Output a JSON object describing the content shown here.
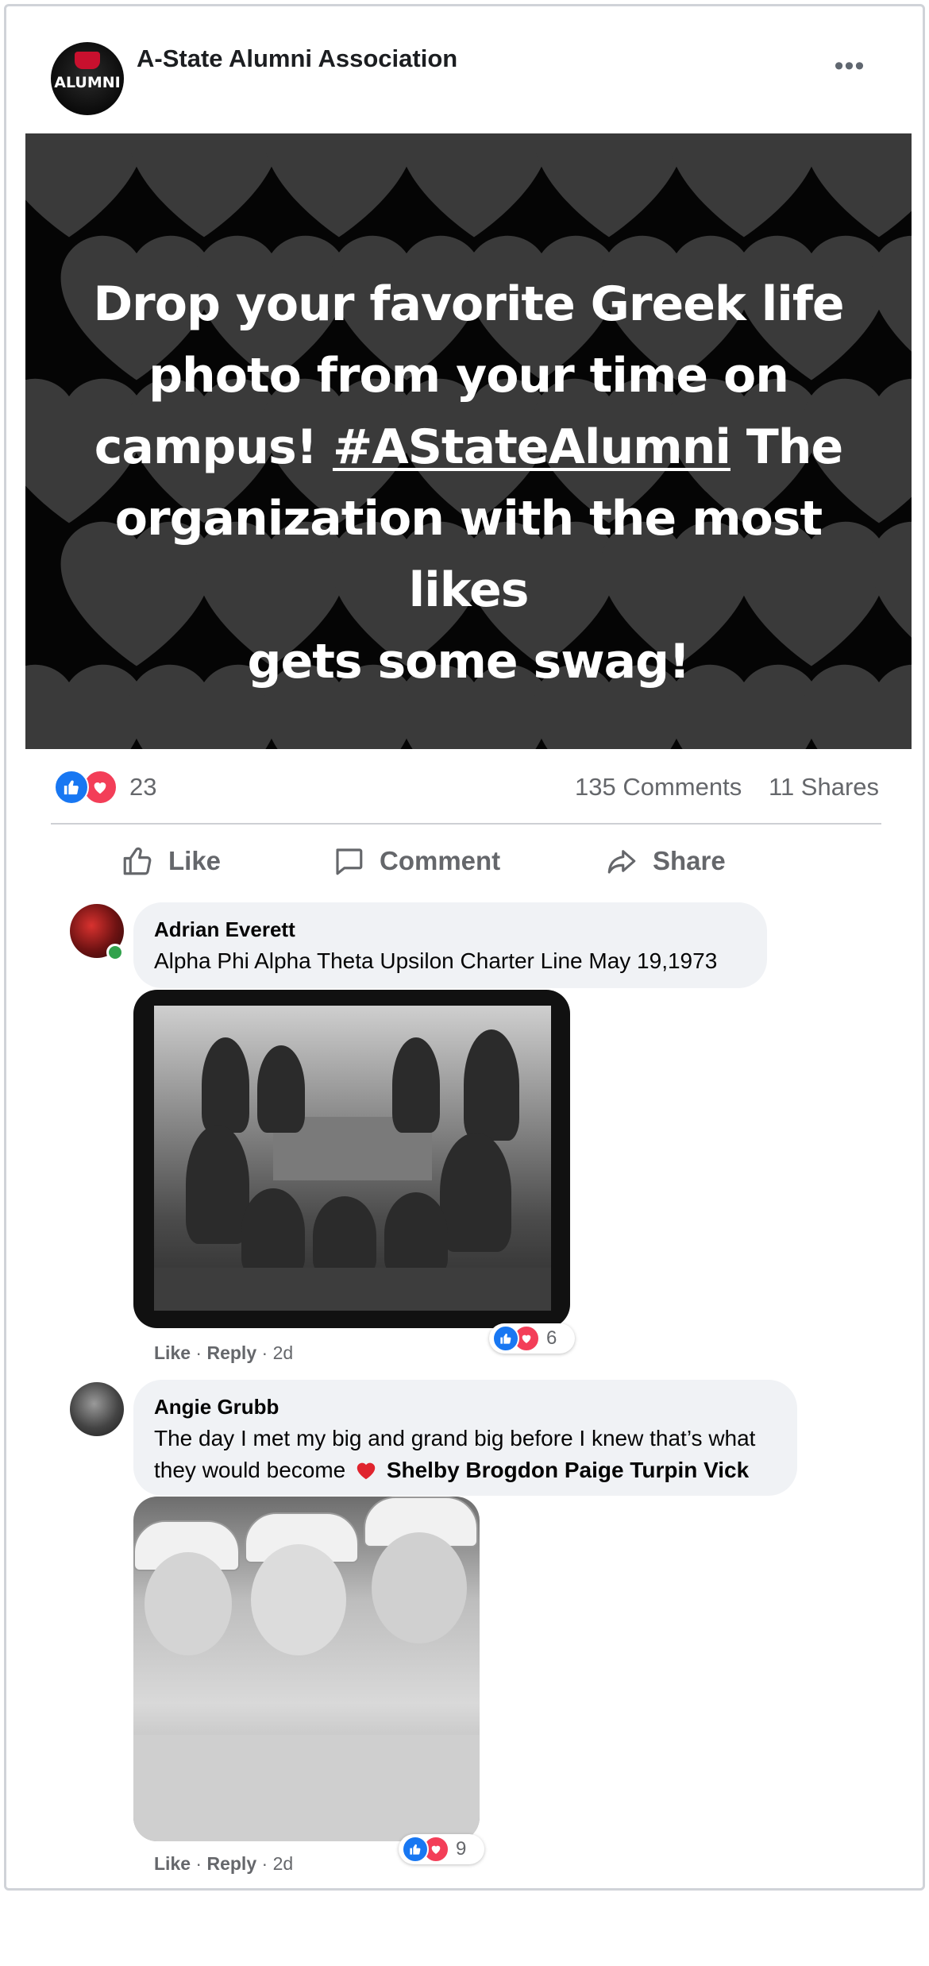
{
  "post": {
    "page_name": "A-State Alumni Association",
    "avatar_word": "ALUMNI",
    "more_label": "•••",
    "banner_text": {
      "line1": "Drop your favorite Greek life",
      "line2": "photo from your time on",
      "line3_pre": "campus! ",
      "hashtag": "#AStateAlumni",
      "line3_post": " The",
      "line4": "organization with the most likes",
      "line5": "gets some swag!"
    },
    "reactions_count": "23",
    "comments_count": "135 Comments",
    "shares_count": "11 Shares",
    "actions": {
      "like": "Like",
      "comment": "Comment",
      "share": "Share"
    }
  },
  "comments": [
    {
      "author": "Adrian Everett",
      "text": "Alpha Phi Alpha Theta Upsilon Charter Line May 19,1973",
      "reactions": "6",
      "like_label": "Like",
      "reply_label": "Reply",
      "time": "2d",
      "online": true
    },
    {
      "author": "Angie Grubb",
      "text_line1": "The day I met my big and grand big before I knew that’s what",
      "text_line2_pre": "they would become",
      "tagged": "Shelby Brogdon Paige Turpin Vick",
      "reactions": "9",
      "like_label": "Like",
      "reply_label": "Reply",
      "time": "2d"
    }
  ],
  "colors": {
    "like_blue": "#1877f2",
    "love_red": "#f33e58",
    "online_green": "#31a24c"
  }
}
